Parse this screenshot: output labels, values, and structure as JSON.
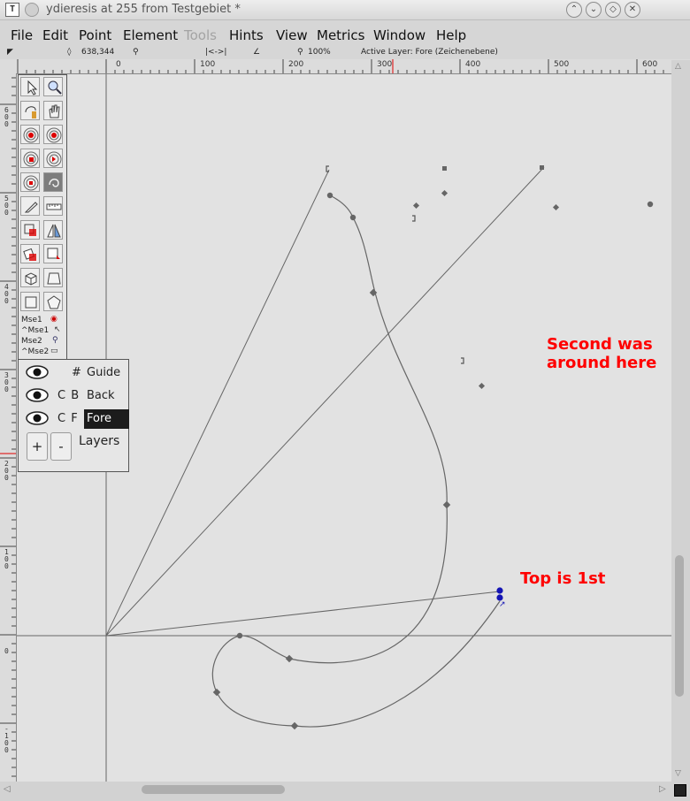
{
  "window": {
    "title": "ydieresis at 255 from Testgebiet *",
    "app_icon": "T",
    "buttons": [
      "shade-up-icon",
      "shade-down-icon",
      "maximize-icon",
      "close-icon"
    ]
  },
  "menubar": [
    {
      "label": "File",
      "enabled": true
    },
    {
      "label": "Edit",
      "enabled": true
    },
    {
      "label": "Point",
      "enabled": true
    },
    {
      "label": "Element",
      "enabled": true
    },
    {
      "label": "Tools",
      "enabled": false
    },
    {
      "label": "Hints",
      "enabled": true
    },
    {
      "label": "View",
      "enabled": true
    },
    {
      "label": "Metrics",
      "enabled": true
    },
    {
      "label": "Window",
      "enabled": true
    },
    {
      "label": "Help",
      "enabled": true
    }
  ],
  "infobar": {
    "coords": "638,344",
    "zoom": "100%",
    "active_layer": "Active Layer: Fore (Zeichenebene)"
  },
  "rulers": {
    "h_labels": [
      "0",
      "100",
      "200",
      "300",
      "400",
      "500",
      "600"
    ],
    "v_labels": [
      "600",
      "500",
      "400",
      "300",
      "200",
      "100",
      "0",
      "-100"
    ]
  },
  "tools": {
    "mouse": [
      "Mse1",
      "^Mse1",
      "Mse2",
      "^Mse2"
    ]
  },
  "layers": {
    "rows": [
      {
        "flags": "#",
        "name": "Guide",
        "visible": true,
        "active": false
      },
      {
        "flags": "C B",
        "name": "Back",
        "visible": true,
        "active": false
      },
      {
        "flags": "C F",
        "name": "Fore",
        "visible": true,
        "active": true
      }
    ],
    "add": "+",
    "remove": "-",
    "label": "Layers"
  },
  "annotations": {
    "second": "Second was\naround here",
    "first": "Top is 1st",
    "color": "#ff0000"
  },
  "colors": {
    "canvas": "#e2e2e2",
    "selected_point": "#0000b0",
    "outline": "#555555"
  }
}
